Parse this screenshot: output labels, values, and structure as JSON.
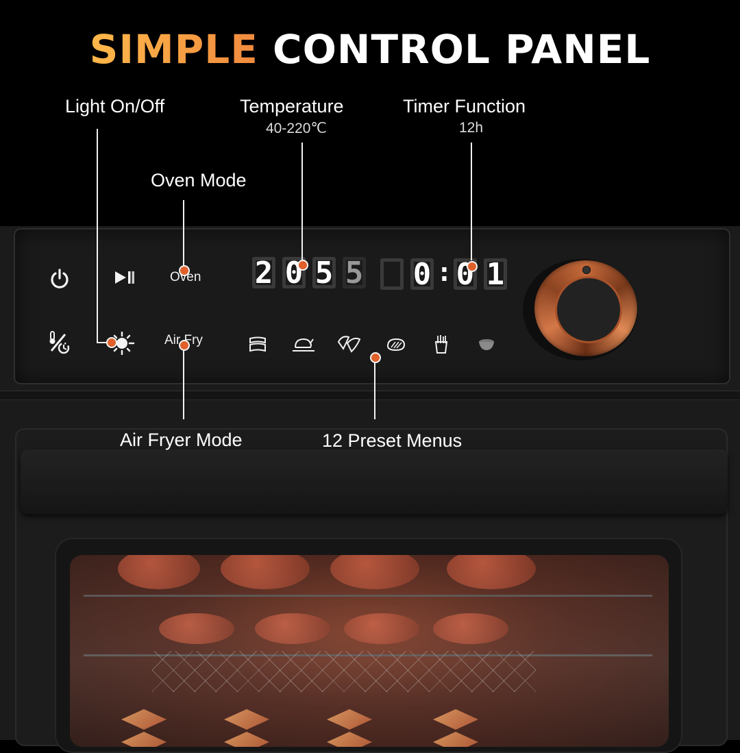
{
  "title": {
    "accent": "SIMPLE",
    "rest": "CONTROL PANEL"
  },
  "colors": {
    "accent_start": "#ffb84a",
    "accent_end": "#f08a3e",
    "callout_dot": "#e0602a",
    "knob_copper": "#c66a3a"
  },
  "callouts": {
    "light": {
      "label": "Light On/Off"
    },
    "temperature": {
      "label": "Temperature",
      "sub": "40-220℃"
    },
    "timer": {
      "label": "Timer Function",
      "sub": "12h"
    },
    "oven_mode": {
      "label": "Oven Mode"
    },
    "air_fryer_mode": {
      "label": "Air Fryer Mode"
    },
    "preset_menus": {
      "label": "12 Preset Menus"
    }
  },
  "panel": {
    "buttons": [
      {
        "name": "power",
        "icon": "power-icon",
        "glyph": "⏻"
      },
      {
        "name": "start-pause",
        "icon": "play-pause-icon",
        "glyph": "▶❚"
      },
      {
        "name": "oven",
        "label": "Oven"
      },
      {
        "name": "temp-time",
        "icon": "temp-time-toggle-icon",
        "glyph": "🌡/◷"
      },
      {
        "name": "light",
        "icon": "light-icon",
        "glyph": "✹"
      },
      {
        "name": "airfry",
        "label": "Air Fry"
      }
    ],
    "display": {
      "temperature_digits": [
        "2",
        "0",
        "5",
        "5"
      ],
      "timer_digits": [
        "",
        "0",
        ":",
        "0",
        "1"
      ],
      "temperature_text": "2055",
      "timer_text": "0:01"
    },
    "presets": [
      {
        "name": "bacon",
        "icon": "bacon-icon"
      },
      {
        "name": "chicken",
        "icon": "roast-chicken-icon"
      },
      {
        "name": "wings",
        "icon": "chicken-wings-icon"
      },
      {
        "name": "steak",
        "icon": "steak-icon"
      },
      {
        "name": "fries",
        "icon": "fries-icon"
      },
      {
        "name": "bowl",
        "icon": "bowl-icon"
      }
    ]
  }
}
